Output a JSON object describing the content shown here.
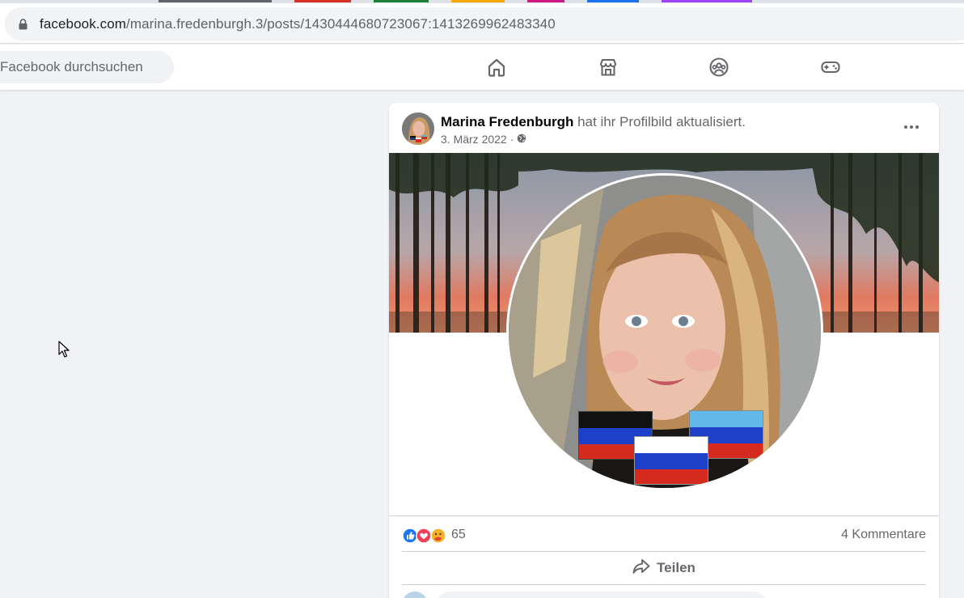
{
  "browser": {
    "url_domain": "facebook.com",
    "url_path": "/marina.fredenburgh.3/posts/1430444680723067:1413269962483340",
    "lock_icon": "lock-icon",
    "tab_colors": [
      "#5f6368",
      "#d93025",
      "#188038",
      "#f9ab00",
      "#d01884",
      "#1a73e8",
      "#a142f4"
    ]
  },
  "header": {
    "search_placeholder": "Facebook durchsuchen",
    "nav_icons": [
      "home-icon",
      "marketplace-icon",
      "groups-icon",
      "gaming-icon"
    ]
  },
  "post": {
    "author": "Marina Fredenburgh",
    "action": " hat ihr Profilbild aktualisiert.",
    "date": "3. März 2022",
    "separator": "·",
    "audience_icon": "globe-icon",
    "reaction_count": "65",
    "comments": "4 Kommentare",
    "share_label": "Teilen"
  },
  "colors": {
    "fb_blue": "#1877f2",
    "love_red": "#f33e58",
    "text_secondary": "#65676b",
    "background": "#f0f2f5"
  }
}
